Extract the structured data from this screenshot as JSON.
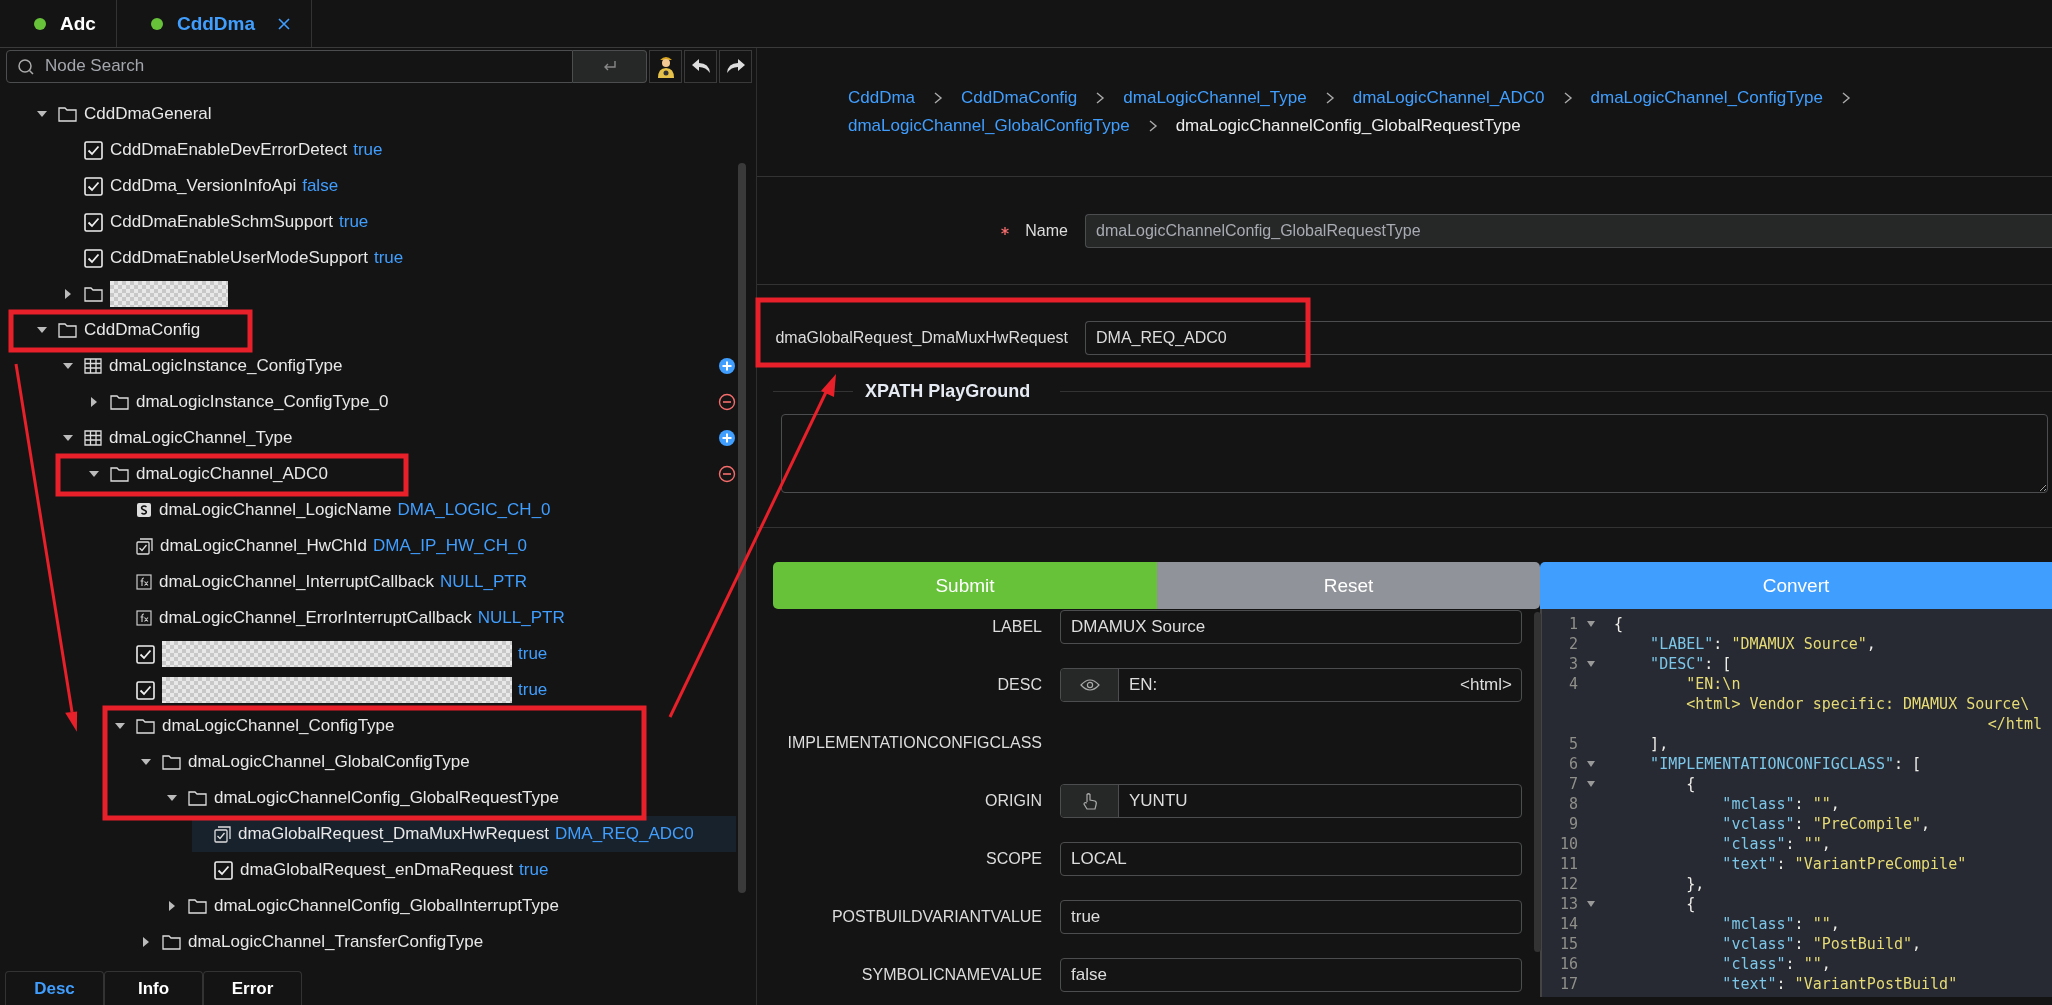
{
  "tabs": [
    {
      "label": "Adc",
      "selected": false,
      "closable": false
    },
    {
      "label": "CddDma",
      "selected": true,
      "closable": true
    }
  ],
  "search": {
    "placeholder": "Node Search"
  },
  "tree": [
    {
      "kind": "folder",
      "label": "CddDmaGeneral",
      "expanded": true,
      "selected": false,
      "children": [
        {
          "kind": "boolean",
          "label": "CddDmaEnableDevErrorDetect",
          "value": "true",
          "checked": true,
          "selected": false
        },
        {
          "kind": "boolean",
          "label": "CddDma_VersionInfoApi",
          "value": "false",
          "checked": true,
          "selected": false
        },
        {
          "kind": "boolean",
          "label": "CddDmaEnableSchmSupport",
          "value": "true",
          "checked": true,
          "selected": false
        },
        {
          "kind": "boolean",
          "label": "CddDmaEnableUserModeSupport",
          "value": "true",
          "checked": true,
          "selected": false
        },
        {
          "kind": "folder",
          "redacted": true,
          "expanded": false,
          "selected": false
        }
      ]
    },
    {
      "kind": "folder",
      "label": "CddDmaConfig",
      "expanded": true,
      "selected": false,
      "children": [
        {
          "kind": "table",
          "label": "dmaLogicInstance_ConfigType",
          "expanded": true,
          "addable": true,
          "selected": false,
          "children": [
            {
              "kind": "folder",
              "label": "dmaLogicInstance_ConfigType_0",
              "expanded": false,
              "removable": true,
              "selected": false
            }
          ]
        },
        {
          "kind": "table",
          "label": "dmaLogicChannel_Type",
          "expanded": true,
          "addable": true,
          "selected": false,
          "children": [
            {
              "kind": "folder",
              "label": "dmaLogicChannel_ADC0",
              "expanded": true,
              "removable": true,
              "selected": false,
              "children": [
                {
                  "kind": "string",
                  "label": "dmaLogicChannel_LogicName",
                  "value": "DMA_LOGIC_CH_0",
                  "selected": false
                },
                {
                  "kind": "enum",
                  "label": "dmaLogicChannel_HwChId",
                  "value": "DMA_IP_HW_CH_0",
                  "selected": false
                },
                {
                  "kind": "function",
                  "label": "dmaLogicChannel_InterruptCallback",
                  "value": "NULL_PTR",
                  "selected": false
                },
                {
                  "kind": "function",
                  "label": "dmaLogicChannel_ErrorInterruptCallback",
                  "value": "NULL_PTR",
                  "selected": false
                },
                {
                  "kind": "boolean",
                  "redacted": true,
                  "value": "true",
                  "checked": true,
                  "selected": false
                },
                {
                  "kind": "boolean",
                  "redacted": true,
                  "value": "true",
                  "checked": true,
                  "selected": false
                },
                {
                  "kind": "folder",
                  "label": "dmaLogicChannel_ConfigType",
                  "expanded": true,
                  "selected": false,
                  "children": [
                    {
                      "kind": "folder",
                      "label": "dmaLogicChannel_GlobalConfigType",
                      "expanded": true,
                      "selected": false,
                      "children": [
                        {
                          "kind": "folder",
                          "label": "dmaLogicChannelConfig_GlobalRequestType",
                          "expanded": true,
                          "selected": false,
                          "children": [
                            {
                              "kind": "enum",
                              "label": "dmaGlobalRequest_DmaMuxHwRequest",
                              "value": "DMA_REQ_ADC0",
                              "selected": true
                            },
                            {
                              "kind": "boolean",
                              "label": "dmaGlobalRequest_enDmaRequest",
                              "value": "true",
                              "checked": true,
                              "selected": false
                            }
                          ]
                        },
                        {
                          "kind": "folder",
                          "label": "dmaLogicChannelConfig_GlobalInterruptType",
                          "expanded": false,
                          "selected": false
                        }
                      ]
                    },
                    {
                      "kind": "folder",
                      "label": "dmaLogicChannel_TransferConfigType",
                      "expanded": false,
                      "selected": false
                    }
                  ]
                }
              ]
            }
          ]
        }
      ]
    }
  ],
  "bottom_tabs": [
    {
      "label": "Desc",
      "selected": true
    },
    {
      "label": "Info",
      "selected": false
    },
    {
      "label": "Error",
      "selected": false
    }
  ],
  "breadcrumb": [
    {
      "label": "CddDma",
      "current": false
    },
    {
      "label": "CddDmaConfig",
      "current": false
    },
    {
      "label": "dmaLogicChannel_Type",
      "current": false
    },
    {
      "label": "dmaLogicChannel_ADC0",
      "current": false
    },
    {
      "label": "dmaLogicChannel_ConfigType",
      "current": false
    },
    {
      "label": "dmaLogicChannel_GlobalConfigType",
      "current": false
    },
    {
      "label": "dmaLogicChannelConfig_GlobalRequestType",
      "current": true
    }
  ],
  "name_field": {
    "label": "Name",
    "required": true,
    "value": "dmaLogicChannelConfig_GlobalRequestType",
    "disabled": true
  },
  "request_field": {
    "label": "dmaGlobalRequest_DmaMuxHwRequest",
    "value": "DMA_REQ_ADC0"
  },
  "xpath": {
    "title": "XPATH PlayGround"
  },
  "buttons": [
    {
      "label": "Submit",
      "kind": "submit"
    },
    {
      "label": "Reset",
      "kind": "reset"
    }
  ],
  "properties": [
    {
      "label": "LABEL",
      "kind": "text",
      "value": "DMAMUX Source"
    },
    {
      "label": "DESC",
      "kind": "preview",
      "value": "EN:",
      "suffix": "<html>"
    },
    {
      "label": "IMPLEMENTATIONCONFIGCLASS",
      "kind": "none"
    },
    {
      "label": "ORIGIN",
      "kind": "pick",
      "value": "YUNTU"
    },
    {
      "label": "SCOPE",
      "kind": "text",
      "value": "LOCAL"
    },
    {
      "label": "POSTBUILDVARIANTVALUE",
      "kind": "text",
      "value": "true"
    },
    {
      "label": "SYMBOLICNAMEVALUE",
      "kind": "text",
      "value": "false"
    }
  ],
  "code": {
    "button": "Convert",
    "lines": [
      {
        "number": "1",
        "foldable": true,
        "tokens": [
          {
            "kind": "punct",
            "text": "{"
          }
        ],
        "children": [
          {
            "number": "2",
            "foldable": false,
            "tokens": [
              {
                "kind": "key",
                "text": "\"LABEL\""
              },
              {
                "kind": "punct",
                "text": ": "
              },
              {
                "kind": "string",
                "text": "\"DMAMUX Source\""
              },
              {
                "kind": "punct",
                "text": ","
              }
            ]
          },
          {
            "number": "3",
            "foldable": true,
            "tokens": [
              {
                "kind": "key",
                "text": "\"DESC\""
              },
              {
                "kind": "punct",
                "text": ": ["
              }
            ],
            "children": [
              {
                "number": "4",
                "foldable": false,
                "tokens": [
                  {
                    "kind": "string",
                    "text": "\"EN:\\n"
                  }
                ],
                "wrap": [
                  "<html> Vendor specific: DMAMUX Source\\",
                  "</html"
                ]
              }
            ]
          },
          {
            "number": "5",
            "foldable": false,
            "tokens": [
              {
                "kind": "punct",
                "text": "],"
              }
            ]
          },
          {
            "number": "6",
            "foldable": true,
            "tokens": [
              {
                "kind": "key",
                "text": "\"IMPLEMENTATIONCONFIGCLASS\""
              },
              {
                "kind": "punct",
                "text": ": ["
              }
            ],
            "children": [
              {
                "number": "7",
                "foldable": true,
                "tokens": [
                  {
                    "kind": "punct",
                    "text": "{"
                  }
                ],
                "children": [
                  {
                    "number": "8",
                    "foldable": false,
                    "tokens": [
                      {
                        "kind": "key",
                        "text": "\"mclass\""
                      },
                      {
                        "kind": "punct",
                        "text": ": "
                      },
                      {
                        "kind": "string",
                        "text": "\"\""
                      },
                      {
                        "kind": "punct",
                        "text": ","
                      }
                    ]
                  },
                  {
                    "number": "9",
                    "foldable": false,
                    "tokens": [
                      {
                        "kind": "key",
                        "text": "\"vclass\""
                      },
                      {
                        "kind": "punct",
                        "text": ": "
                      },
                      {
                        "kind": "string",
                        "text": "\"PreCompile\""
                      },
                      {
                        "kind": "punct",
                        "text": ","
                      }
                    ]
                  },
                  {
                    "number": "10",
                    "foldable": false,
                    "tokens": [
                      {
                        "kind": "key",
                        "text": "\"class\""
                      },
                      {
                        "kind": "punct",
                        "text": ": "
                      },
                      {
                        "kind": "string",
                        "text": "\"\""
                      },
                      {
                        "kind": "punct",
                        "text": ","
                      }
                    ]
                  },
                  {
                    "number": "11",
                    "foldable": false,
                    "tokens": [
                      {
                        "kind": "key",
                        "text": "\"text\""
                      },
                      {
                        "kind": "punct",
                        "text": ": "
                      },
                      {
                        "kind": "string",
                        "text": "\"VariantPreCompile\""
                      }
                    ]
                  }
                ]
              },
              {
                "number": "12",
                "foldable": false,
                "tokens": [
                  {
                    "kind": "punct",
                    "text": "},"
                  }
                ]
              },
              {
                "number": "13",
                "foldable": true,
                "tokens": [
                  {
                    "kind": "punct",
                    "text": "{"
                  }
                ],
                "children": [
                  {
                    "number": "14",
                    "foldable": false,
                    "tokens": [
                      {
                        "kind": "key",
                        "text": "\"mclass\""
                      },
                      {
                        "kind": "punct",
                        "text": ": "
                      },
                      {
                        "kind": "string",
                        "text": "\"\""
                      },
                      {
                        "kind": "punct",
                        "text": ","
                      }
                    ]
                  },
                  {
                    "number": "15",
                    "foldable": false,
                    "tokens": [
                      {
                        "kind": "key",
                        "text": "\"vclass\""
                      },
                      {
                        "kind": "punct",
                        "text": ": "
                      },
                      {
                        "kind": "string",
                        "text": "\"PostBuild\""
                      },
                      {
                        "kind": "punct",
                        "text": ","
                      }
                    ]
                  },
                  {
                    "number": "16",
                    "foldable": false,
                    "tokens": [
                      {
                        "kind": "key",
                        "text": "\"class\""
                      },
                      {
                        "kind": "punct",
                        "text": ": "
                      },
                      {
                        "kind": "string",
                        "text": "\"\""
                      },
                      {
                        "kind": "punct",
                        "text": ","
                      }
                    ]
                  },
                  {
                    "number": "17",
                    "foldable": false,
                    "tokens": [
                      {
                        "kind": "key",
                        "text": "\"text\""
                      },
                      {
                        "kind": "punct",
                        "text": ": "
                      },
                      {
                        "kind": "string",
                        "text": "\"VariantPostBuild\""
                      }
                    ]
                  }
                ]
              }
            ]
          }
        ]
      }
    ]
  }
}
